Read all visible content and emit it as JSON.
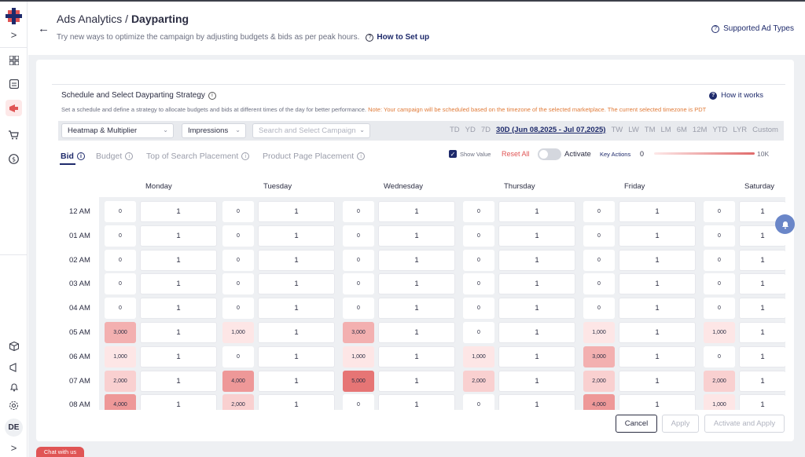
{
  "header": {
    "title_prefix": "Ads Analytics / ",
    "title_main": "Dayparting",
    "subtitle": "Try new ways to optimize the campaign by adjusting budgets & bids as per peak hours.",
    "setup_link": "How to Set up",
    "supported_link": "Supported Ad Types"
  },
  "nav": {
    "avatar": "DE",
    "expand": ">"
  },
  "strategy": {
    "title": "Schedule and Select Dayparting Strategy",
    "how_it_works": "How it works",
    "description": "Set a schedule and define a strategy to allocate budgets and bids at different times of the day for better performance.",
    "note": "Note: Your campaign will be scheduled based on the timezone of the selected marketplace. The current selected timezone is PDT"
  },
  "toolbar": {
    "view_select": "Heatmap & Multiplier",
    "metric_select": "Impressions",
    "campaign_placeholder": "Search and Select Campaign",
    "ranges": [
      "TD",
      "YD",
      "7D",
      "30D (Jun 08,2025 - Jul 07,2025)",
      "TW",
      "LW",
      "TM",
      "LM",
      "6M",
      "12M",
      "YTD",
      "LYR",
      "Custom"
    ],
    "active_range": "30D (Jun 08,2025 - Jul 07,2025)"
  },
  "tabs": [
    "Bid",
    "Budget",
    "Top of Search Placement",
    "Product Page Placement"
  ],
  "active_tab": "Bid",
  "controls": {
    "show_value": "Show Value",
    "reset_all": "Reset All",
    "activate": "Activate",
    "key_actions": "Key Actions",
    "scale_min": "0",
    "scale_max": "10K"
  },
  "grid": {
    "days": [
      "Monday",
      "Tuesday",
      "Wednesday",
      "Thursday",
      "Friday",
      "Saturday"
    ],
    "hours": [
      "12 AM",
      "01 AM",
      "02 AM",
      "03 AM",
      "04 AM",
      "05 AM",
      "06 AM",
      "07 AM",
      "08 AM"
    ],
    "values": [
      [
        "0",
        "0",
        "0",
        "0",
        "0",
        "0"
      ],
      [
        "0",
        "0",
        "0",
        "0",
        "0",
        "0"
      ],
      [
        "0",
        "0",
        "0",
        "0",
        "0",
        "0"
      ],
      [
        "0",
        "0",
        "0",
        "0",
        "0",
        "0"
      ],
      [
        "0",
        "0",
        "0",
        "0",
        "0",
        "0"
      ],
      [
        "3,000",
        "1,000",
        "3,000",
        "0",
        "1,000",
        "1,000"
      ],
      [
        "1,000",
        "0",
        "1,000",
        "1,000",
        "3,000",
        "0"
      ],
      [
        "2,000",
        "4,000",
        "5,000",
        "2,000",
        "2,000",
        "2,000"
      ],
      [
        "4,000",
        "2,000",
        "0",
        "0",
        "4,000",
        "1,000"
      ]
    ],
    "multiplier": "1",
    "heat_colors": {
      "0": "#ffffff",
      "1,000": "#fde6e6",
      "2,000": "#f9d0d0",
      "3,000": "#f3b0b0",
      "4,000": "#ee9898",
      "5,000": "#e67575"
    }
  },
  "buttons": {
    "cancel": "Cancel",
    "apply": "Apply",
    "activate_apply": "Activate and Apply"
  },
  "chat": "Chat with us"
}
